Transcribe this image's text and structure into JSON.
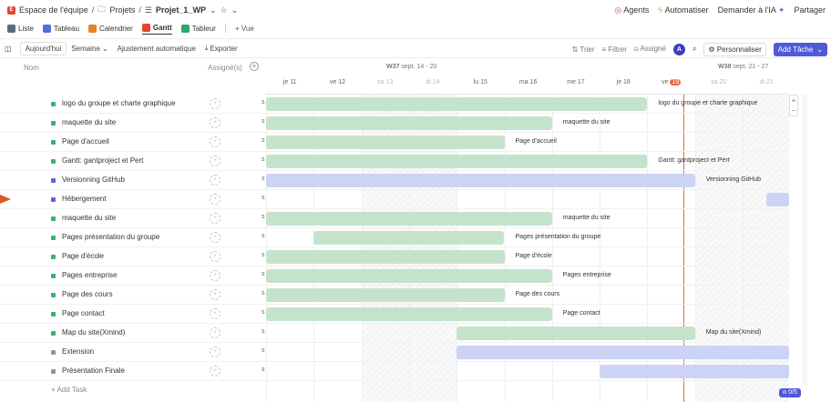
{
  "topbar": {
    "workspace": "Espace de l'équipe",
    "projects": "Projets",
    "list": "Projet_1_WP",
    "agents": "Agents",
    "automate": "Automatiser",
    "ask_ai": "Demander à l'IA",
    "share": "Partager"
  },
  "tabs": [
    {
      "label": "Liste",
      "color": "#5b6b7a"
    },
    {
      "label": "Tableau",
      "color": "#4f6fd8"
    },
    {
      "label": "Calendrier",
      "color": "#e8832a"
    },
    {
      "label": "Gantt",
      "color": "#e0472f"
    },
    {
      "label": "Tableur",
      "color": "#2fa66a"
    }
  ],
  "add_view": "+ Vue",
  "toolbar": {
    "today": "Aujourd'hui",
    "week": "Semaine",
    "auto_fit": "Ajustement automatique",
    "export": "Exporter",
    "sort": "Trier",
    "filter": "Filtrer",
    "assigned": "Assigné",
    "avatar_initial": "A",
    "customize": "Personnaliser",
    "add_task": "Add Tâche"
  },
  "columns": {
    "name": "Nom",
    "assignee": "Assigné(s)"
  },
  "weeks": [
    {
      "label": "W37",
      "range": "sept. 14 - 20"
    },
    {
      "label": "W38",
      "range": "sept. 21 - 27"
    }
  ],
  "days": [
    {
      "label": "je 11",
      "weekend": false
    },
    {
      "label": "ve 12",
      "weekend": false
    },
    {
      "label": "sa 13",
      "weekend": true
    },
    {
      "label": "di 14",
      "weekend": true
    },
    {
      "label": "lu 15",
      "weekend": false
    },
    {
      "label": "ma 16",
      "weekend": false
    },
    {
      "label": "me 17",
      "weekend": false
    },
    {
      "label": "je 18",
      "weekend": false
    },
    {
      "label": "ve",
      "weekend": false,
      "badge": "19"
    },
    {
      "label": "sa 20",
      "weekend": true
    },
    {
      "label": "di 21",
      "weekend": true
    }
  ],
  "status_letter": "s",
  "tasks": [
    {
      "name": "logo du groupe et charte graphique",
      "dot": "#3bb26a",
      "start": 0,
      "end": 8,
      "bar": "green",
      "label": "logo du groupe et charte graphique"
    },
    {
      "name": "maquette du site",
      "dot": "#3bb26a",
      "start": 0,
      "end": 6,
      "bar": "green",
      "label": "maquette du site"
    },
    {
      "name": "Page d'accueil",
      "dot": "#3bb26a",
      "start": 0,
      "end": 5,
      "bar": "green",
      "label": "Page d'accueil"
    },
    {
      "name": "Gantt: gantproject et Pert",
      "dot": "#3bb26a",
      "start": 0,
      "end": 8,
      "bar": "green",
      "label": "Gantt: gantproject et Pert"
    },
    {
      "name": "Versionning GitHub",
      "dot": "#5866d8",
      "start": 0,
      "end": 9,
      "bar": "blue",
      "label": "Versionning GitHub"
    },
    {
      "name": "Hébergement",
      "dot": "#5866d8",
      "start": 10.5,
      "end": 11,
      "bar": "blue",
      "label": ""
    },
    {
      "name": "maquette du site",
      "dot": "#3bb26a",
      "start": 0,
      "end": 6,
      "bar": "green",
      "label": "maquette du site"
    },
    {
      "name": "Pages présentation du groupe",
      "dot": "#3bb26a",
      "start": 1,
      "end": 5,
      "bar": "green",
      "label": "Pages présentation du groupe"
    },
    {
      "name": "Page d'école",
      "dot": "#3bb26a",
      "start": 0,
      "end": 5,
      "bar": "green",
      "label": "Page d'école"
    },
    {
      "name": "Pages entreprise",
      "dot": "#3bb26a",
      "start": 0,
      "end": 6,
      "bar": "green",
      "label": "Pages entreprise"
    },
    {
      "name": "Page des cours",
      "dot": "#3bb26a",
      "start": 0,
      "end": 5,
      "bar": "green",
      "label": "Page des cours"
    },
    {
      "name": "Page contact",
      "dot": "#3bb26a",
      "start": 0,
      "end": 6,
      "bar": "green",
      "label": "Page contact"
    },
    {
      "name": "Map du site(Xmind)",
      "dot": "#3bb26a",
      "start": 4,
      "end": 9,
      "bar": "green",
      "label": "Map du site(Xmind)"
    },
    {
      "name": "Extension",
      "dot": "#8a94a6",
      "start": 4,
      "end": 11,
      "bar": "blue",
      "label": ""
    },
    {
      "name": "Présentation Finale",
      "dot": "#8a94a6",
      "start": 7,
      "end": 11,
      "bar": "blue",
      "label": ""
    }
  ],
  "add_task_row": "+ Add Task",
  "counter": "0/5",
  "zoom_in": "+",
  "zoom_out": "−"
}
